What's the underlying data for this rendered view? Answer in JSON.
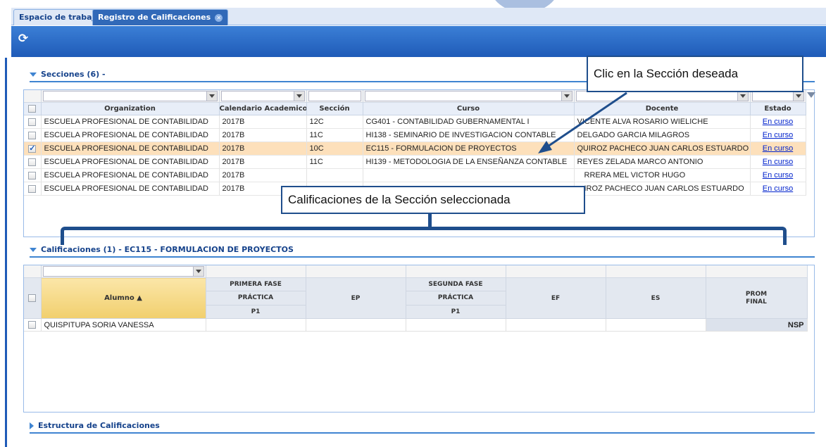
{
  "tabs": [
    {
      "label": "Espacio de trabajo"
    },
    {
      "label": "Registro de Calificaciones"
    }
  ],
  "toolbar": {
    "refresh_icon": "refresh-icon"
  },
  "secciones": {
    "header": "Secciones (6) -",
    "columns": [
      "Organization",
      "Calendario Academico",
      "Sección",
      "Curso",
      "Docente",
      "Estado"
    ],
    "rows": [
      {
        "org": "ESCUELA PROFESIONAL DE CONTABILIDAD",
        "cal": "2017B",
        "sec": "12C",
        "curso": "CG401 - CONTABILIDAD GUBERNAMENTAL I",
        "docente": "VICENTE ALVA ROSARIO WIELICHE",
        "estado": "En curso",
        "checked": false
      },
      {
        "org": "ESCUELA PROFESIONAL DE CONTABILIDAD",
        "cal": "2017B",
        "sec": "11C",
        "curso": "HI138 - SEMINARIO DE INVESTIGACION CONTABLE",
        "docente": "DELGADO GARCIA MILAGROS",
        "estado": "En curso",
        "checked": false
      },
      {
        "org": "ESCUELA PROFESIONAL DE CONTABILIDAD",
        "cal": "2017B",
        "sec": "10C",
        "curso": "EC115 - FORMULACION DE PROYECTOS",
        "docente": "QUIROZ PACHECO JUAN CARLOS ESTUARDO",
        "estado": "En curso",
        "checked": true
      },
      {
        "org": "ESCUELA PROFESIONAL DE CONTABILIDAD",
        "cal": "2017B",
        "sec": "11C",
        "curso": "HI139 - METODOLOGIA DE LA ENSEÑANZA CONTABLE",
        "docente": "REYES ZELADA MARCO ANTONIO",
        "estado": "En curso",
        "checked": false
      },
      {
        "org": "ESCUELA PROFESIONAL DE CONTABILIDAD",
        "cal": "2017B",
        "sec": "",
        "curso": "",
        "docente": "RRERA MEL VICTOR HUGO",
        "estado": "En curso",
        "checked": false
      },
      {
        "org": "ESCUELA PROFESIONAL DE CONTABILIDAD",
        "cal": "2017B",
        "sec": "",
        "curso": "",
        "docente": "IROZ PACHECO JUAN CARLOS ESTUARDO",
        "estado": "En curso",
        "checked": false
      }
    ]
  },
  "calificaciones": {
    "header": "Calificaciones (1) - EC115 - FORMULACION DE PROYECTOS",
    "col_alumno": "Alumno ▲",
    "primera_fase": "PRIMERA FASE",
    "segunda_fase": "SEGUNDA FASE",
    "practica": "PRÁCTICA",
    "p1": "P1",
    "ep": "EP",
    "ef": "EF",
    "es": "ES",
    "prom_final": "PROM FINAL",
    "rows": [
      {
        "alumno": "QUISPITUPA SORIA VANESSA",
        "prom_final": "NSP"
      }
    ]
  },
  "estructura": {
    "header": "Estructura de Calificaciones"
  },
  "callouts": {
    "seccion": "Clic en la Sección deseada",
    "calificaciones": "Calificaciones de la Sección seleccionada"
  }
}
